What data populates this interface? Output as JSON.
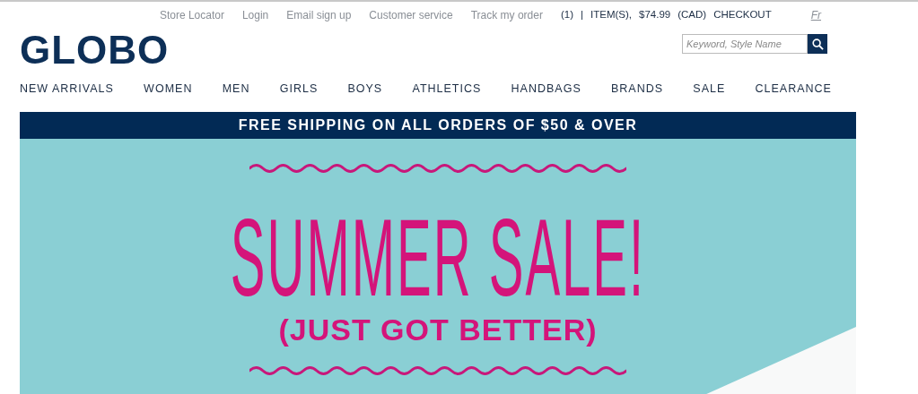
{
  "top_links": [
    "Store Locator",
    "Login",
    "Email sign up",
    "Customer service",
    "Track my order"
  ],
  "cart": {
    "count": "(1)",
    "separator": "|",
    "items_label": "ITEM(S),",
    "total": "$74.99",
    "currency": "(CAD)",
    "checkout": "CHECKOUT"
  },
  "language_link": "Fr",
  "logo": "GLOBO",
  "search": {
    "placeholder": "Keyword, Style Name"
  },
  "nav": [
    "NEW ARRIVALS",
    "WOMEN",
    "MEN",
    "GIRLS",
    "BOYS",
    "ATHLETICS",
    "HANDBAGS",
    "BRANDS",
    "SALE",
    "CLEARANCE"
  ],
  "promo_strip": "FREE SHIPPING ON ALL ORDERS OF $50 & OVER",
  "hero": {
    "headline": "SUMMER SALE!",
    "subheadline": "(JUST GOT BETTER)"
  }
}
